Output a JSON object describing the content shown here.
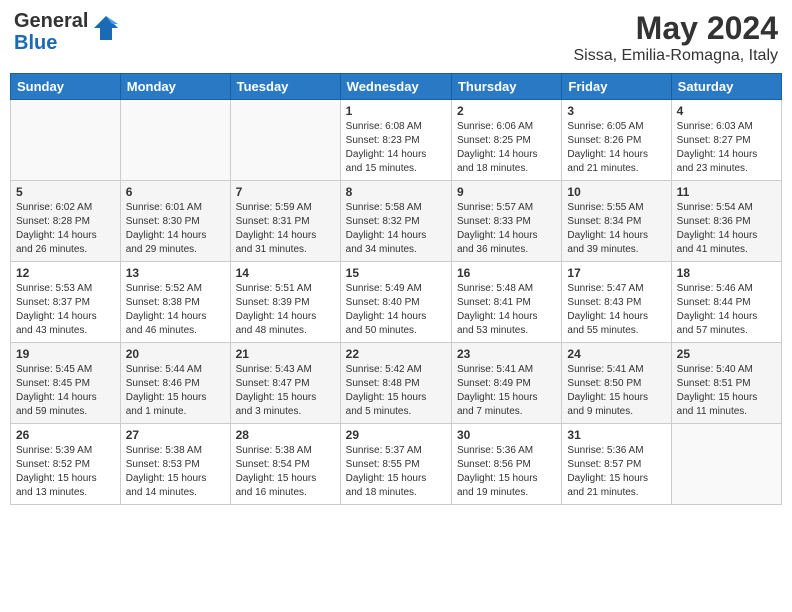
{
  "header": {
    "logo_line1": "General",
    "logo_line2": "Blue",
    "month_year": "May 2024",
    "location": "Sissa, Emilia-Romagna, Italy"
  },
  "days_of_week": [
    "Sunday",
    "Monday",
    "Tuesday",
    "Wednesday",
    "Thursday",
    "Friday",
    "Saturday"
  ],
  "weeks": [
    [
      {
        "num": "",
        "info": ""
      },
      {
        "num": "",
        "info": ""
      },
      {
        "num": "",
        "info": ""
      },
      {
        "num": "1",
        "info": "Sunrise: 6:08 AM\nSunset: 8:23 PM\nDaylight: 14 hours\nand 15 minutes."
      },
      {
        "num": "2",
        "info": "Sunrise: 6:06 AM\nSunset: 8:25 PM\nDaylight: 14 hours\nand 18 minutes."
      },
      {
        "num": "3",
        "info": "Sunrise: 6:05 AM\nSunset: 8:26 PM\nDaylight: 14 hours\nand 21 minutes."
      },
      {
        "num": "4",
        "info": "Sunrise: 6:03 AM\nSunset: 8:27 PM\nDaylight: 14 hours\nand 23 minutes."
      }
    ],
    [
      {
        "num": "5",
        "info": "Sunrise: 6:02 AM\nSunset: 8:28 PM\nDaylight: 14 hours\nand 26 minutes."
      },
      {
        "num": "6",
        "info": "Sunrise: 6:01 AM\nSunset: 8:30 PM\nDaylight: 14 hours\nand 29 minutes."
      },
      {
        "num": "7",
        "info": "Sunrise: 5:59 AM\nSunset: 8:31 PM\nDaylight: 14 hours\nand 31 minutes."
      },
      {
        "num": "8",
        "info": "Sunrise: 5:58 AM\nSunset: 8:32 PM\nDaylight: 14 hours\nand 34 minutes."
      },
      {
        "num": "9",
        "info": "Sunrise: 5:57 AM\nSunset: 8:33 PM\nDaylight: 14 hours\nand 36 minutes."
      },
      {
        "num": "10",
        "info": "Sunrise: 5:55 AM\nSunset: 8:34 PM\nDaylight: 14 hours\nand 39 minutes."
      },
      {
        "num": "11",
        "info": "Sunrise: 5:54 AM\nSunset: 8:36 PM\nDaylight: 14 hours\nand 41 minutes."
      }
    ],
    [
      {
        "num": "12",
        "info": "Sunrise: 5:53 AM\nSunset: 8:37 PM\nDaylight: 14 hours\nand 43 minutes."
      },
      {
        "num": "13",
        "info": "Sunrise: 5:52 AM\nSunset: 8:38 PM\nDaylight: 14 hours\nand 46 minutes."
      },
      {
        "num": "14",
        "info": "Sunrise: 5:51 AM\nSunset: 8:39 PM\nDaylight: 14 hours\nand 48 minutes."
      },
      {
        "num": "15",
        "info": "Sunrise: 5:49 AM\nSunset: 8:40 PM\nDaylight: 14 hours\nand 50 minutes."
      },
      {
        "num": "16",
        "info": "Sunrise: 5:48 AM\nSunset: 8:41 PM\nDaylight: 14 hours\nand 53 minutes."
      },
      {
        "num": "17",
        "info": "Sunrise: 5:47 AM\nSunset: 8:43 PM\nDaylight: 14 hours\nand 55 minutes."
      },
      {
        "num": "18",
        "info": "Sunrise: 5:46 AM\nSunset: 8:44 PM\nDaylight: 14 hours\nand 57 minutes."
      }
    ],
    [
      {
        "num": "19",
        "info": "Sunrise: 5:45 AM\nSunset: 8:45 PM\nDaylight: 14 hours\nand 59 minutes."
      },
      {
        "num": "20",
        "info": "Sunrise: 5:44 AM\nSunset: 8:46 PM\nDaylight: 15 hours\nand 1 minute."
      },
      {
        "num": "21",
        "info": "Sunrise: 5:43 AM\nSunset: 8:47 PM\nDaylight: 15 hours\nand 3 minutes."
      },
      {
        "num": "22",
        "info": "Sunrise: 5:42 AM\nSunset: 8:48 PM\nDaylight: 15 hours\nand 5 minutes."
      },
      {
        "num": "23",
        "info": "Sunrise: 5:41 AM\nSunset: 8:49 PM\nDaylight: 15 hours\nand 7 minutes."
      },
      {
        "num": "24",
        "info": "Sunrise: 5:41 AM\nSunset: 8:50 PM\nDaylight: 15 hours\nand 9 minutes."
      },
      {
        "num": "25",
        "info": "Sunrise: 5:40 AM\nSunset: 8:51 PM\nDaylight: 15 hours\nand 11 minutes."
      }
    ],
    [
      {
        "num": "26",
        "info": "Sunrise: 5:39 AM\nSunset: 8:52 PM\nDaylight: 15 hours\nand 13 minutes."
      },
      {
        "num": "27",
        "info": "Sunrise: 5:38 AM\nSunset: 8:53 PM\nDaylight: 15 hours\nand 14 minutes."
      },
      {
        "num": "28",
        "info": "Sunrise: 5:38 AM\nSunset: 8:54 PM\nDaylight: 15 hours\nand 16 minutes."
      },
      {
        "num": "29",
        "info": "Sunrise: 5:37 AM\nSunset: 8:55 PM\nDaylight: 15 hours\nand 18 minutes."
      },
      {
        "num": "30",
        "info": "Sunrise: 5:36 AM\nSunset: 8:56 PM\nDaylight: 15 hours\nand 19 minutes."
      },
      {
        "num": "31",
        "info": "Sunrise: 5:36 AM\nSunset: 8:57 PM\nDaylight: 15 hours\nand 21 minutes."
      },
      {
        "num": "",
        "info": ""
      }
    ]
  ]
}
